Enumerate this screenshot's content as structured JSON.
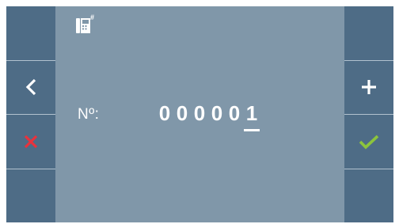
{
  "panel": {
    "label": "Nº:",
    "digits": [
      "0",
      "0",
      "0",
      "0",
      "0",
      "1"
    ],
    "cursor_index": 5
  },
  "icons": {
    "status": "intercom-phone-icon",
    "left_buttons": [
      "",
      "back-chevron-icon",
      "cancel-x-icon",
      ""
    ],
    "right_buttons": [
      "",
      "plus-icon",
      "confirm-check-icon",
      ""
    ]
  },
  "colors": {
    "screen_bg": "#8097a9",
    "side_panel": "#4e6c86",
    "divider": "#b2c2cf",
    "cancel": "#e8323c",
    "confirm": "#8cc43c",
    "text": "#ffffff"
  }
}
